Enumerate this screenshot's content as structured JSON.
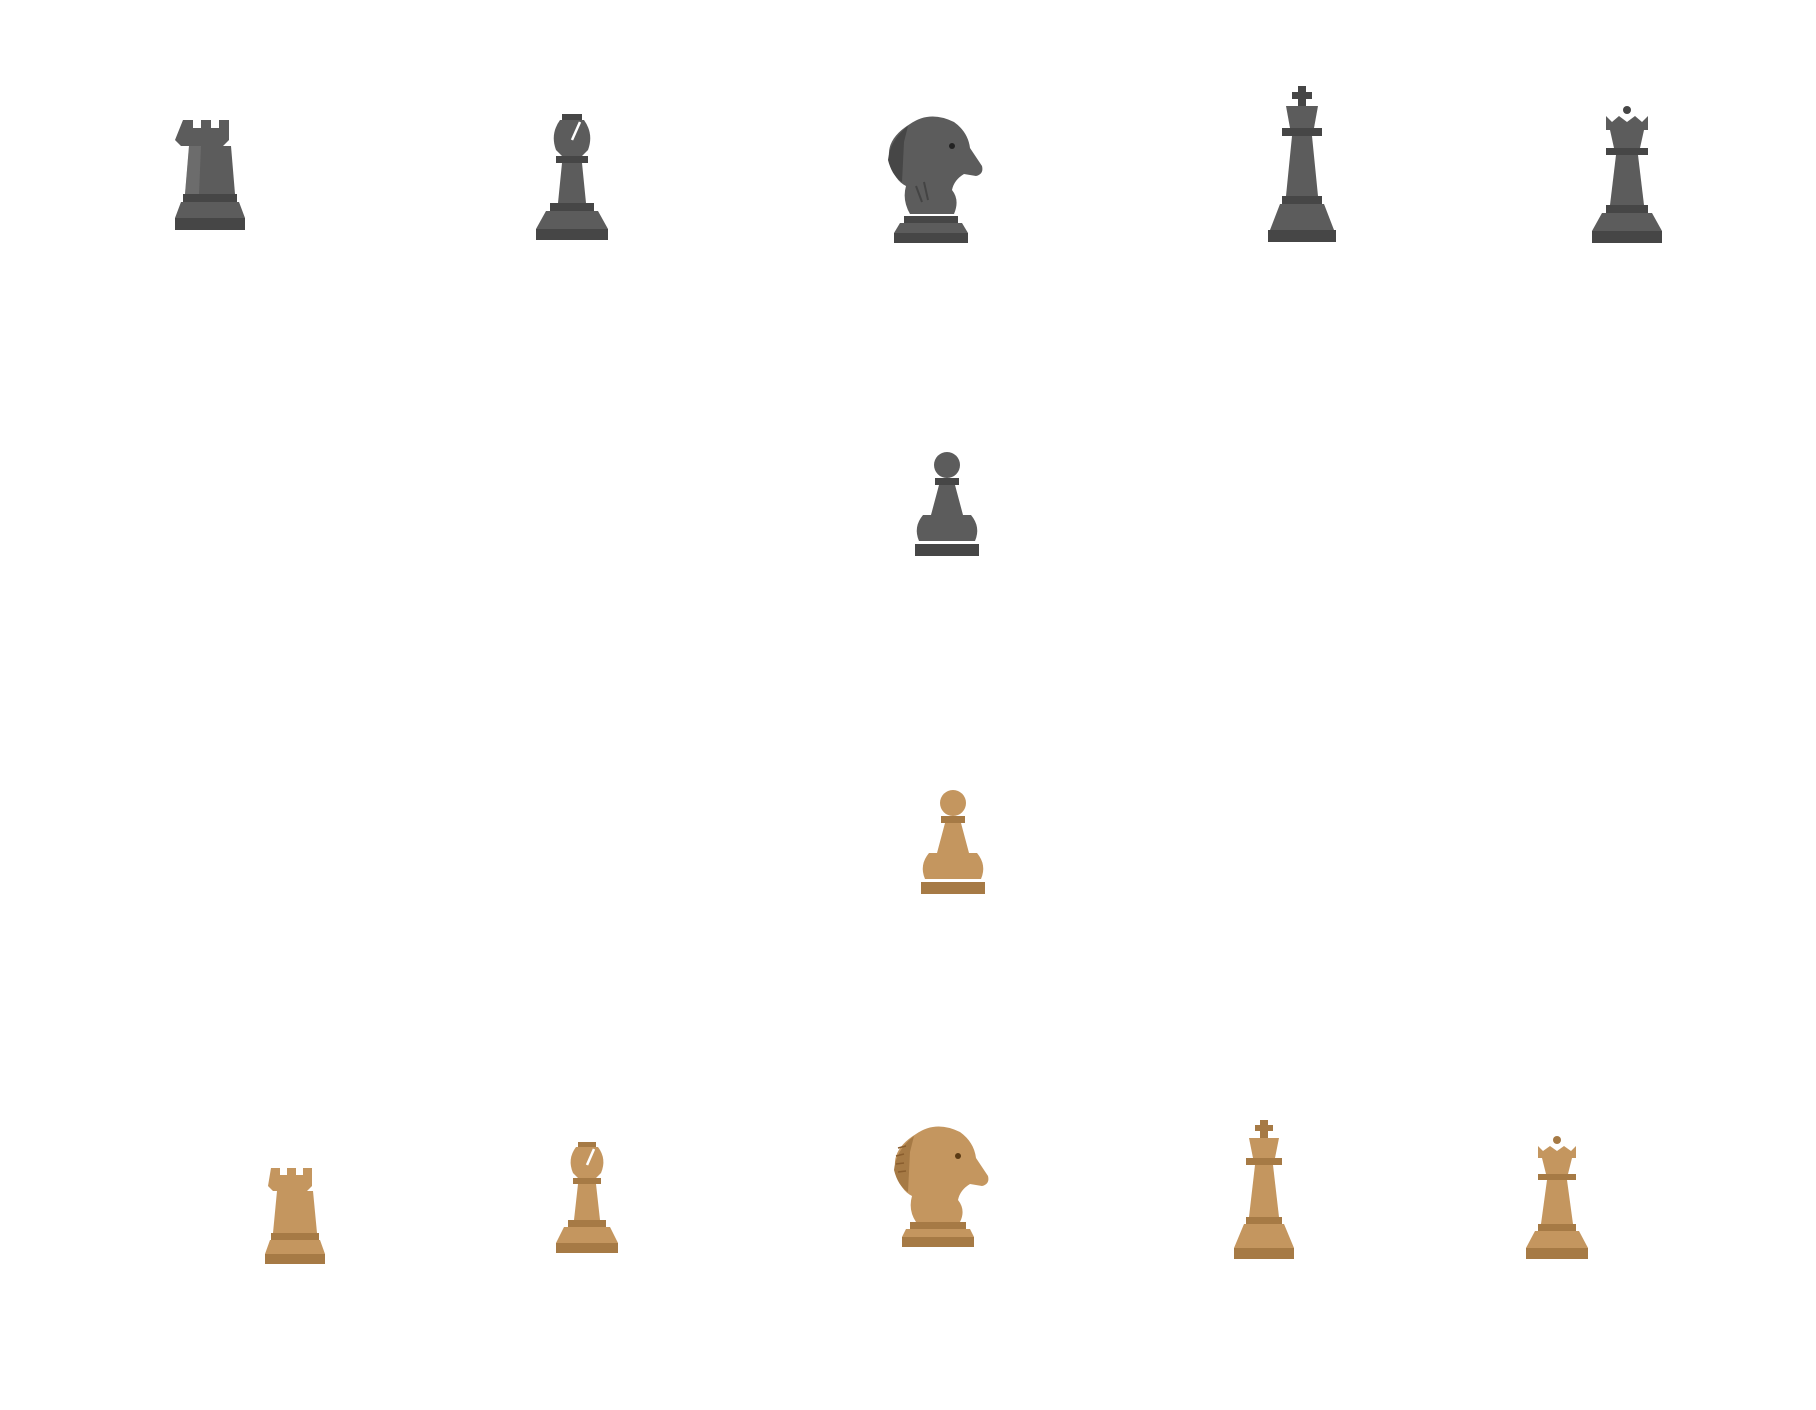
{
  "colors": {
    "background": "#ffffff",
    "dark_main": "#5a5a5a",
    "dark_shade": "#454545",
    "dark_light": "#7a7a7a",
    "light_main": "#c4965f",
    "light_shade": "#a67a45",
    "light_light": "#dfbb8a"
  },
  "pieces": {
    "dark": [
      {
        "name": "rook",
        "icon": "rook-icon"
      },
      {
        "name": "bishop",
        "icon": "bishop-icon"
      },
      {
        "name": "knight",
        "icon": "knight-icon"
      },
      {
        "name": "king",
        "icon": "king-icon"
      },
      {
        "name": "queen",
        "icon": "queen-icon"
      },
      {
        "name": "pawn",
        "icon": "pawn-icon"
      }
    ],
    "light": [
      {
        "name": "pawn",
        "icon": "pawn-icon"
      },
      {
        "name": "rook",
        "icon": "rook-icon"
      },
      {
        "name": "bishop",
        "icon": "bishop-icon"
      },
      {
        "name": "knight",
        "icon": "knight-icon"
      },
      {
        "name": "king",
        "icon": "king-icon"
      },
      {
        "name": "queen",
        "icon": "queen-icon"
      }
    ]
  }
}
